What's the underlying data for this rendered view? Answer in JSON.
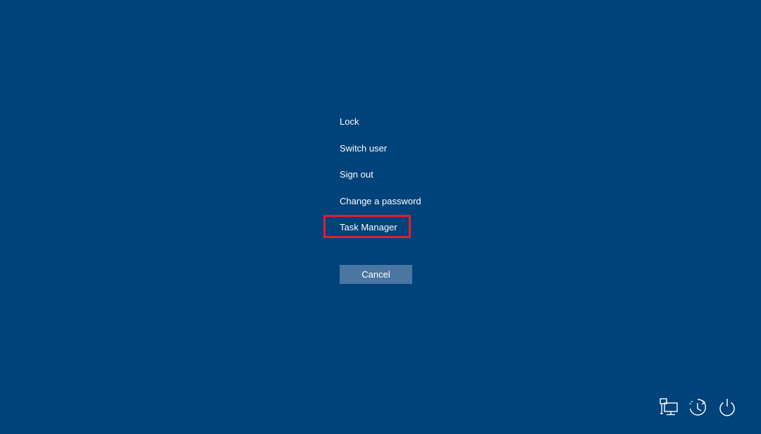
{
  "menu": {
    "items": [
      {
        "label": "Lock"
      },
      {
        "label": "Switch user"
      },
      {
        "label": "Sign out"
      },
      {
        "label": "Change a password"
      },
      {
        "label": "Task Manager"
      }
    ]
  },
  "cancel": {
    "label": "Cancel"
  },
  "tray": {
    "icons": [
      "network-icon",
      "accessibility-icon",
      "power-icon"
    ]
  },
  "colors": {
    "background": "#00427a",
    "highlight": "#e0202e",
    "button": "#4a77a1"
  }
}
